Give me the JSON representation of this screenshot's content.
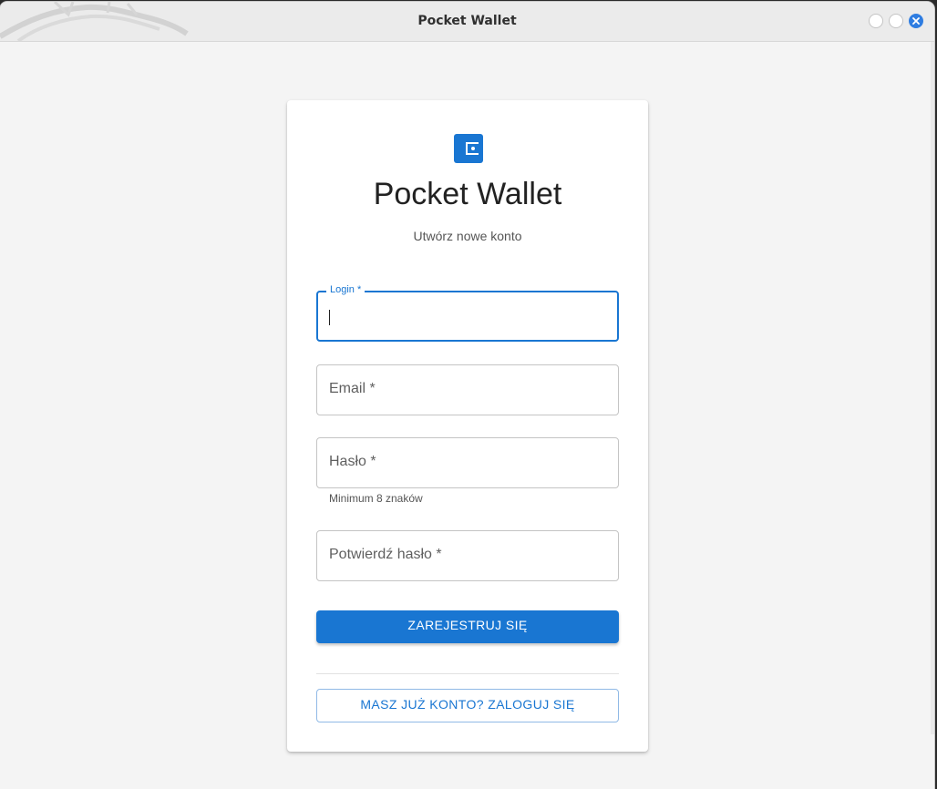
{
  "window": {
    "title": "Pocket Wallet",
    "controls": [
      "minimize",
      "maximize",
      "close"
    ]
  },
  "app": {
    "title": "Pocket Wallet",
    "subtitle": "Utwórz nowe konto",
    "logo_icon": "wallet-icon",
    "accent": "#1976d2"
  },
  "form": {
    "fields": [
      {
        "label": "Login *",
        "value": "",
        "state": "focused"
      },
      {
        "label": "Email *",
        "value": ""
      },
      {
        "label": "Hasło *",
        "value": "",
        "helper": "Minimum 8 znaków"
      },
      {
        "label": "Potwierdź hasło *",
        "value": ""
      }
    ],
    "submit_label": "ZAREJESTRUJ SIĘ",
    "login_link_label": "MASZ JUŻ KONTO? ZALOGUJ SIĘ"
  }
}
